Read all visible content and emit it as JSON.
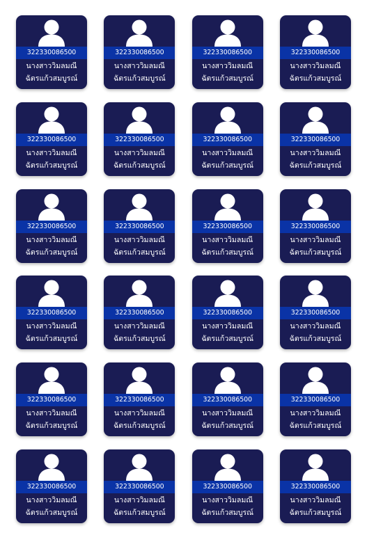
{
  "cards": [
    {
      "id": "322330086500",
      "first_name": "นางสาววิมลมณี",
      "last_name": "ฉัตรแก้วสมบูรณ์"
    },
    {
      "id": "322330086500",
      "first_name": "นางสาววิมลมณี",
      "last_name": "ฉัตรแก้วสมบูรณ์"
    },
    {
      "id": "322330086500",
      "first_name": "นางสาววิมลมณี",
      "last_name": "ฉัตรแก้วสมบูรณ์"
    },
    {
      "id": "322330086500",
      "first_name": "นางสาววิมลมณี",
      "last_name": "ฉัตรแก้วสมบูรณ์"
    },
    {
      "id": "322330086500",
      "first_name": "นางสาววิมลมณี",
      "last_name": "ฉัตรแก้วสมบูรณ์"
    },
    {
      "id": "322330086500",
      "first_name": "นางสาววิมลมณี",
      "last_name": "ฉัตรแก้วสมบูรณ์"
    },
    {
      "id": "322330086500",
      "first_name": "นางสาววิมลมณี",
      "last_name": "ฉัตรแก้วสมบูรณ์"
    },
    {
      "id": "322330086500",
      "first_name": "นางสาววิมลมณี",
      "last_name": "ฉัตรแก้วสมบูรณ์"
    },
    {
      "id": "322330086500",
      "first_name": "นางสาววิมลมณี",
      "last_name": "ฉัตรแก้วสมบูรณ์"
    },
    {
      "id": "322330086500",
      "first_name": "นางสาววิมลมณี",
      "last_name": "ฉัตรแก้วสมบูรณ์"
    },
    {
      "id": "322330086500",
      "first_name": "นางสาววิมลมณี",
      "last_name": "ฉัตรแก้วสมบูรณ์"
    },
    {
      "id": "322330086500",
      "first_name": "นางสาววิมลมณี",
      "last_name": "ฉัตรแก้วสมบูรณ์"
    },
    {
      "id": "322330086500",
      "first_name": "นางสาววิมลมณี",
      "last_name": "ฉัตรแก้วสมบูรณ์"
    },
    {
      "id": "322330086500",
      "first_name": "นางสาววิมลมณี",
      "last_name": "ฉัตรแก้วสมบูรณ์"
    },
    {
      "id": "322330086500",
      "first_name": "นางสาววิมลมณี",
      "last_name": "ฉัตรแก้วสมบูรณ์"
    },
    {
      "id": "322330086500",
      "first_name": "นางสาววิมลมณี",
      "last_name": "ฉัตรแก้วสมบูรณ์"
    },
    {
      "id": "322330086500",
      "first_name": "นางสาววิมลมณี",
      "last_name": "ฉัตรแก้วสมบูรณ์"
    },
    {
      "id": "322330086500",
      "first_name": "นางสาววิมลมณี",
      "last_name": "ฉัตรแก้วสมบูรณ์"
    },
    {
      "id": "322330086500",
      "first_name": "นางสาววิมลมณี",
      "last_name": "ฉัตรแก้วสมบูรณ์"
    },
    {
      "id": "322330086500",
      "first_name": "นางสาววิมลมณี",
      "last_name": "ฉัตรแก้วสมบูรณ์"
    },
    {
      "id": "322330086500",
      "first_name": "นางสาววิมลมณี",
      "last_name": "ฉัตรแก้วสมบูรณ์"
    },
    {
      "id": "322330086500",
      "first_name": "นางสาววิมลมณี",
      "last_name": "ฉัตรแก้วสมบูรณ์"
    },
    {
      "id": "322330086500",
      "first_name": "นางสาววิมลมณี",
      "last_name": "ฉัตรแก้วสมบูรณ์"
    },
    {
      "id": "322330086500",
      "first_name": "นางสาววิมลมณี",
      "last_name": "ฉัตรแก้วสมบูรณ์"
    }
  ],
  "card_icon": "user-avatar-icon",
  "colors": {
    "card_background": "#1a1c54",
    "id_band": "#0a33a6",
    "text": "#ffffff",
    "page_background": "#ffffff"
  }
}
